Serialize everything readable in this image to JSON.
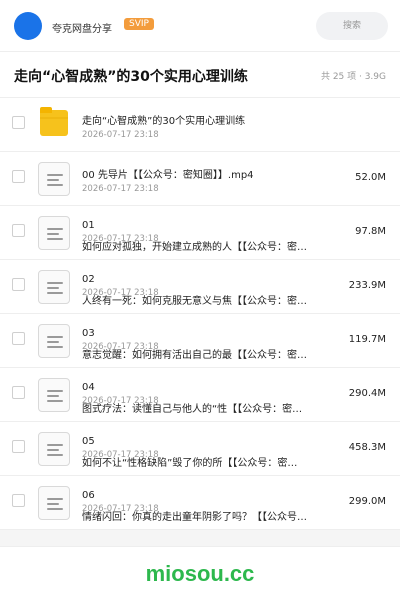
{
  "header": {
    "share_name": "夸克网盘分享",
    "badge": "SVIP",
    "search_placeholder": "搜索"
  },
  "folder": {
    "title": "走向“心智成熟”的30个实用心理训练",
    "meta": "共 25 项 · 3.9G"
  },
  "items": [
    {
      "type": "folder",
      "name": "走向“心智成熟”的30个实用心理训练",
      "date": "2026-07-17 23:18",
      "size": ""
    },
    {
      "type": "file",
      "name": "00 先导片【【公众号：密知圈】】.mp4",
      "date": "2026-07-17 23:18",
      "size": "52.0M"
    },
    {
      "type": "file",
      "name": "01",
      "name2": "如何应对孤独，开始建立成熟的人【【公众号：密…",
      "date": "2026-07-17 23:18",
      "size": "97.8M"
    },
    {
      "type": "file",
      "name": "02",
      "name2": "人终有一死：如何克服无意义与焦【【公众号：密…",
      "date": "2026-07-17 23:18",
      "size": "233.9M"
    },
    {
      "type": "file",
      "name": "03",
      "name2": "意志觉醒：如何拥有活出自己的最【【公众号：密…",
      "date": "2026-07-17 23:18",
      "size": "119.7M"
    },
    {
      "type": "file",
      "name": "04",
      "name2": "图式疗法：读懂自己与他人的“性【【公众号：密…",
      "date": "2026-07-17 23:18",
      "size": "290.4M"
    },
    {
      "type": "file",
      "name": "05",
      "name2": "如何不让“性格缺陷”毁了你的所【【公众号：密…",
      "date": "2026-07-17 23:18",
      "size": "458.3M"
    },
    {
      "type": "file",
      "name": "06",
      "name2": "情绪闪回：你真的走出童年阴影了吗？【【公众号…",
      "date": "2026-07-17 23:18",
      "size": "299.0M"
    }
  ],
  "watermark": "miosou.cc",
  "colors": {
    "accent": "#1a73e8",
    "svip": "#f39c3c",
    "folder": "#f6c21c",
    "watermark": "#2db84d"
  }
}
